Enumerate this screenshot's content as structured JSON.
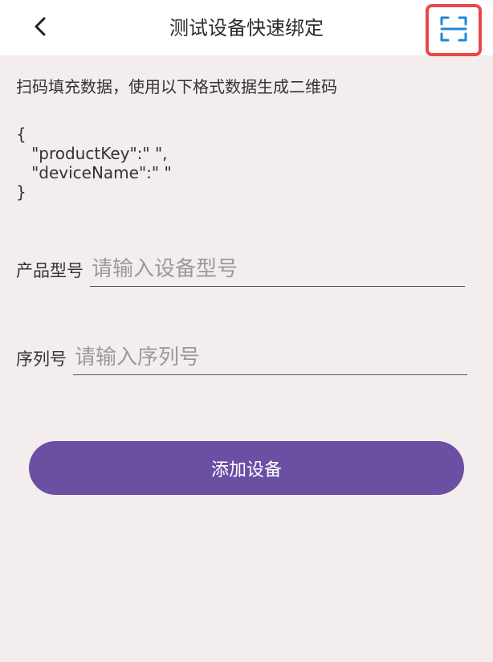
{
  "header": {
    "title": "测试设备快速绑定",
    "back_icon": "chevron-left-icon",
    "scan_icon": "scan-icon",
    "scan_highlight_color": "#e8494a",
    "scan_icon_color": "#1e88d8"
  },
  "hint": "扫码填充数据，使用以下格式数据生成二维码",
  "json_example": "{\n   \"productKey\":\" \",\n   \"deviceName\":\" \"\n}",
  "fields": {
    "product_model": {
      "label": "产品型号",
      "placeholder": "请输入设备型号",
      "value": ""
    },
    "serial_number": {
      "label": "序列号",
      "placeholder": "请输入序列号",
      "value": ""
    }
  },
  "add_button": {
    "label": "添加设备",
    "color": "#6a4fa3"
  },
  "background_color": "#f3edee"
}
